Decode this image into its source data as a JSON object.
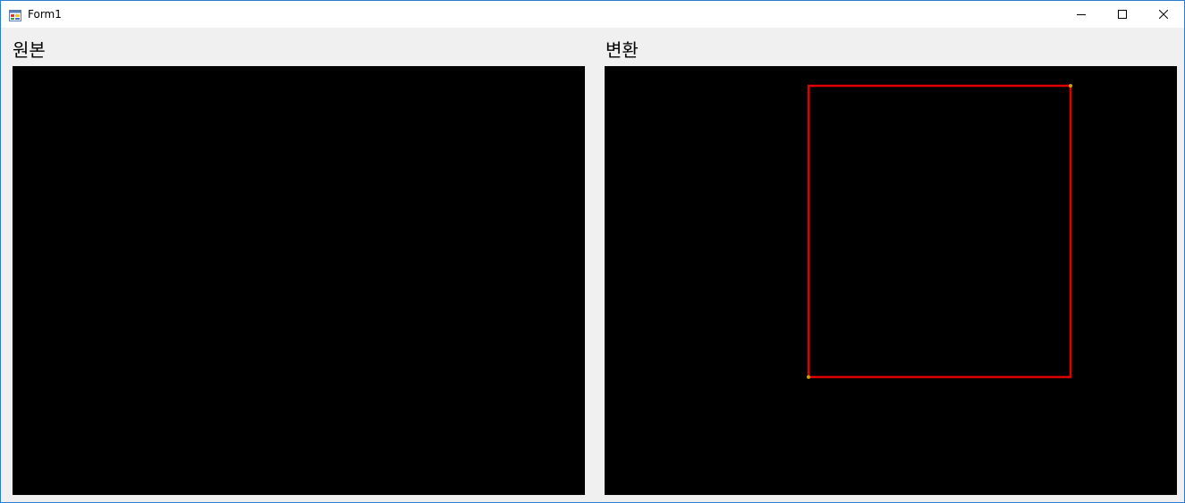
{
  "window": {
    "title": "Form1",
    "icon": "winforms-app-icon",
    "controls": [
      "minimize-icon",
      "maximize-icon",
      "close-icon"
    ]
  },
  "labels": {
    "original": "원본",
    "converted": "변환"
  },
  "colors": {
    "canvas_background": "#000000",
    "rectangle_stroke": "#e00000",
    "corner_marker": "#c8a400",
    "form_background": "#f0f0f0"
  }
}
